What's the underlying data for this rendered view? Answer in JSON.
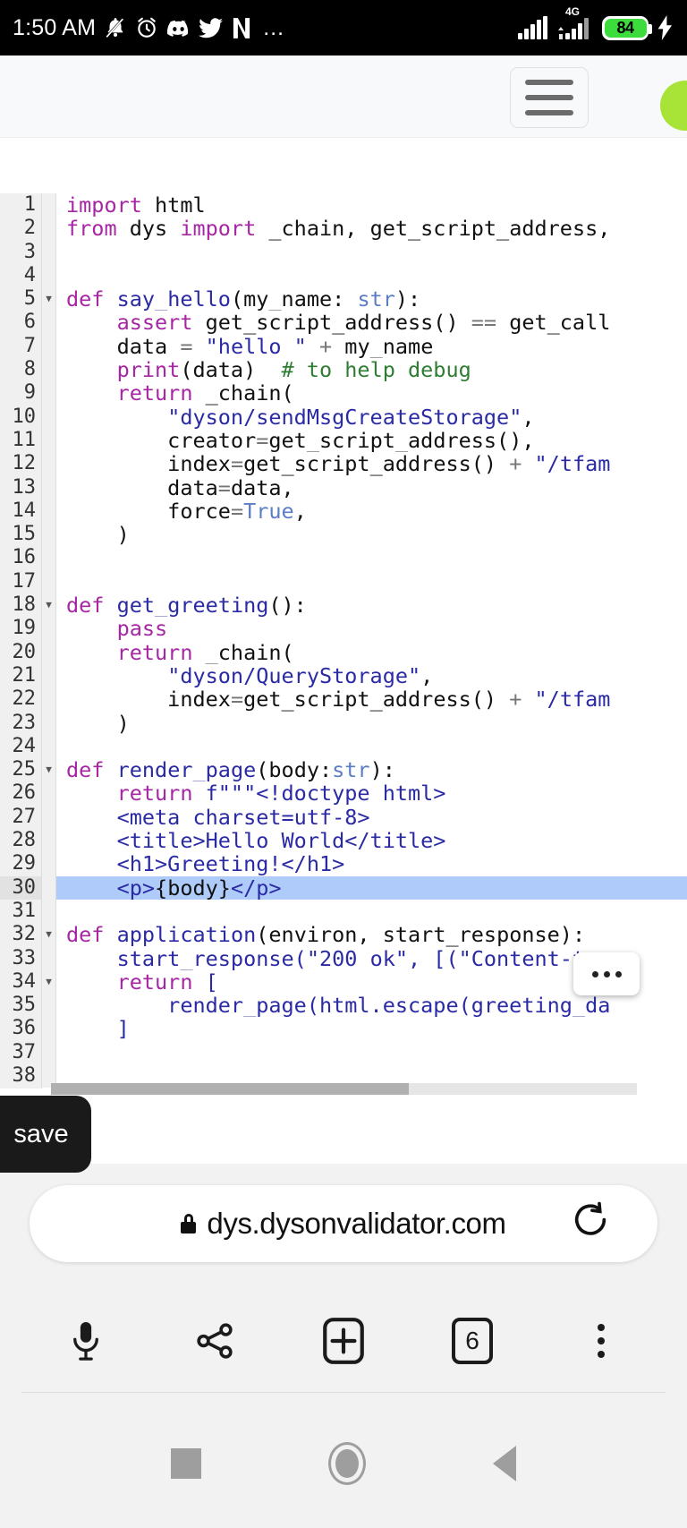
{
  "status_bar": {
    "time": "1:50 AM",
    "icons": [
      "bell-muted-icon",
      "alarm-clock-icon",
      "discord-icon",
      "twitter-icon",
      "netflix-icon"
    ],
    "overflow": "…",
    "network_label": "4G",
    "battery_percent": "84",
    "battery_color": "#3ddc3d",
    "charging": true
  },
  "page": {
    "menu_button": "hamburger-menu",
    "accent_color": "#a8e338"
  },
  "editor": {
    "selected_line": 30,
    "context_menu_label": "...",
    "save_tooltip": "save",
    "total_lines": 38,
    "lines": [
      {
        "n": 1,
        "fold": false,
        "tokens": [
          {
            "t": "import",
            "c": "kw"
          },
          {
            "t": " html",
            "c": "pl"
          }
        ]
      },
      {
        "n": 2,
        "fold": false,
        "tokens": [
          {
            "t": "from",
            "c": "kw"
          },
          {
            "t": " dys ",
            "c": "pl"
          },
          {
            "t": "import",
            "c": "kw"
          },
          {
            "t": " _chain, get_script_address,",
            "c": "pl"
          }
        ]
      },
      {
        "n": 3,
        "fold": false,
        "tokens": []
      },
      {
        "n": 4,
        "fold": false,
        "tokens": []
      },
      {
        "n": 5,
        "fold": true,
        "tokens": [
          {
            "t": "def",
            "c": "kw"
          },
          {
            "t": " ",
            "c": "pl"
          },
          {
            "t": "say_hello",
            "c": "fn"
          },
          {
            "t": "(my_name: ",
            "c": "pl"
          },
          {
            "t": "str",
            "c": "typ"
          },
          {
            "t": "):",
            "c": "pl"
          }
        ]
      },
      {
        "n": 6,
        "fold": false,
        "tokens": [
          {
            "t": "    ",
            "c": "pl"
          },
          {
            "t": "assert",
            "c": "kw"
          },
          {
            "t": " get_script_address() ",
            "c": "pl"
          },
          {
            "t": "==",
            "c": "op"
          },
          {
            "t": " get_call",
            "c": "pl"
          }
        ]
      },
      {
        "n": 7,
        "fold": false,
        "tokens": [
          {
            "t": "    data ",
            "c": "pl"
          },
          {
            "t": "=",
            "c": "op"
          },
          {
            "t": " \"hello \"",
            "c": "str"
          },
          {
            "t": " ",
            "c": "pl"
          },
          {
            "t": "+",
            "c": "op"
          },
          {
            "t": " my_name",
            "c": "pl"
          }
        ]
      },
      {
        "n": 8,
        "fold": false,
        "tokens": [
          {
            "t": "    ",
            "c": "pl"
          },
          {
            "t": "print",
            "c": "kw"
          },
          {
            "t": "(data)  ",
            "c": "pl"
          },
          {
            "t": "# to help debug",
            "c": "cmt"
          }
        ]
      },
      {
        "n": 9,
        "fold": false,
        "tokens": [
          {
            "t": "    ",
            "c": "pl"
          },
          {
            "t": "return",
            "c": "kw"
          },
          {
            "t": " _chain(",
            "c": "pl"
          }
        ]
      },
      {
        "n": 10,
        "fold": false,
        "tokens": [
          {
            "t": "        ",
            "c": "pl"
          },
          {
            "t": "\"dyson/sendMsgCreateStorage\"",
            "c": "str"
          },
          {
            "t": ",",
            "c": "pl"
          }
        ]
      },
      {
        "n": 11,
        "fold": false,
        "tokens": [
          {
            "t": "        creator",
            "c": "pl"
          },
          {
            "t": "=",
            "c": "op"
          },
          {
            "t": "get_script_address(),",
            "c": "pl"
          }
        ]
      },
      {
        "n": 12,
        "fold": false,
        "tokens": [
          {
            "t": "        index",
            "c": "pl"
          },
          {
            "t": "=",
            "c": "op"
          },
          {
            "t": "get_script_address() ",
            "c": "pl"
          },
          {
            "t": "+",
            "c": "op"
          },
          {
            "t": " ",
            "c": "pl"
          },
          {
            "t": "\"/tfam",
            "c": "str"
          }
        ]
      },
      {
        "n": 13,
        "fold": false,
        "tokens": [
          {
            "t": "        data",
            "c": "pl"
          },
          {
            "t": "=",
            "c": "op"
          },
          {
            "t": "data,",
            "c": "pl"
          }
        ]
      },
      {
        "n": 14,
        "fold": false,
        "tokens": [
          {
            "t": "        force",
            "c": "pl"
          },
          {
            "t": "=",
            "c": "op"
          },
          {
            "t": "True",
            "c": "typ"
          },
          {
            "t": ",",
            "c": "pl"
          }
        ]
      },
      {
        "n": 15,
        "fold": false,
        "tokens": [
          {
            "t": "    )",
            "c": "pl"
          }
        ]
      },
      {
        "n": 16,
        "fold": false,
        "tokens": []
      },
      {
        "n": 17,
        "fold": false,
        "tokens": []
      },
      {
        "n": 18,
        "fold": true,
        "tokens": [
          {
            "t": "def",
            "c": "kw"
          },
          {
            "t": " ",
            "c": "pl"
          },
          {
            "t": "get_greeting",
            "c": "fn"
          },
          {
            "t": "():",
            "c": "pl"
          }
        ]
      },
      {
        "n": 19,
        "fold": false,
        "tokens": [
          {
            "t": "    ",
            "c": "pl"
          },
          {
            "t": "pass",
            "c": "kw"
          }
        ]
      },
      {
        "n": 20,
        "fold": false,
        "tokens": [
          {
            "t": "    ",
            "c": "pl"
          },
          {
            "t": "return",
            "c": "kw"
          },
          {
            "t": " _chain(",
            "c": "pl"
          }
        ]
      },
      {
        "n": 21,
        "fold": false,
        "tokens": [
          {
            "t": "        ",
            "c": "pl"
          },
          {
            "t": "\"dyson/QueryStorage\"",
            "c": "str"
          },
          {
            "t": ",",
            "c": "pl"
          }
        ]
      },
      {
        "n": 22,
        "fold": false,
        "tokens": [
          {
            "t": "        index",
            "c": "pl"
          },
          {
            "t": "=",
            "c": "op"
          },
          {
            "t": "get_script_address() ",
            "c": "pl"
          },
          {
            "t": "+",
            "c": "op"
          },
          {
            "t": " ",
            "c": "pl"
          },
          {
            "t": "\"/tfam",
            "c": "str"
          }
        ]
      },
      {
        "n": 23,
        "fold": false,
        "tokens": [
          {
            "t": "    )",
            "c": "pl"
          }
        ]
      },
      {
        "n": 24,
        "fold": false,
        "tokens": []
      },
      {
        "n": 25,
        "fold": true,
        "tokens": [
          {
            "t": "def",
            "c": "kw"
          },
          {
            "t": " ",
            "c": "pl"
          },
          {
            "t": "render_page",
            "c": "fn"
          },
          {
            "t": "(body:",
            "c": "pl"
          },
          {
            "t": "str",
            "c": "typ"
          },
          {
            "t": "):",
            "c": "pl"
          }
        ]
      },
      {
        "n": 26,
        "fold": false,
        "tokens": [
          {
            "t": "    ",
            "c": "pl"
          },
          {
            "t": "return",
            "c": "kw"
          },
          {
            "t": " ",
            "c": "pl"
          },
          {
            "t": "f\"\"\"<!doctype html>",
            "c": "fn"
          }
        ]
      },
      {
        "n": 27,
        "fold": false,
        "tokens": [
          {
            "t": "    <meta charset=utf-8>",
            "c": "fn"
          }
        ]
      },
      {
        "n": 28,
        "fold": false,
        "tokens": [
          {
            "t": "    <title>Hello World</title>",
            "c": "fn"
          }
        ]
      },
      {
        "n": 29,
        "fold": false,
        "tokens": [
          {
            "t": "    <h1>Greeting!</h1>",
            "c": "fn"
          }
        ]
      },
      {
        "n": 30,
        "fold": false,
        "selected": true,
        "tokens": [
          {
            "t": "    <p>",
            "c": "fn"
          },
          {
            "t": "{body}",
            "c": "pl"
          },
          {
            "t": "</p>",
            "c": "fn"
          }
        ]
      },
      {
        "n": 31,
        "fold": false,
        "tokens": []
      },
      {
        "n": 32,
        "fold": true,
        "tokens": [
          {
            "t": "def",
            "c": "kw"
          },
          {
            "t": " ",
            "c": "pl"
          },
          {
            "t": "application",
            "c": "fn"
          },
          {
            "t": "(environ, start_response):",
            "c": "pl"
          }
        ]
      },
      {
        "n": 33,
        "fold": false,
        "tokens": [
          {
            "t": "    start_response(",
            "c": "fn"
          },
          {
            "t": "\"200 ok\"",
            "c": "fn"
          },
          {
            "t": ", [(",
            "c": "fn"
          },
          {
            "t": "\"Content-typ",
            "c": "fn"
          }
        ]
      },
      {
        "n": 34,
        "fold": true,
        "tokens": [
          {
            "t": "    ",
            "c": "pl"
          },
          {
            "t": "return",
            "c": "kw"
          },
          {
            "t": " [",
            "c": "fn"
          }
        ]
      },
      {
        "n": 35,
        "fold": false,
        "tokens": [
          {
            "t": "        render_page(html.escape(greeting_da",
            "c": "fn"
          }
        ]
      },
      {
        "n": 36,
        "fold": false,
        "tokens": [
          {
            "t": "    ]",
            "c": "fn"
          }
        ]
      },
      {
        "n": 37,
        "fold": false,
        "tokens": []
      },
      {
        "n": 38,
        "fold": false,
        "tokens": []
      }
    ]
  },
  "browser": {
    "url": "dys.dysonvalidator.com",
    "secure": true,
    "reload_label": "reload-icon",
    "toolbar": [
      {
        "name": "microphone-icon",
        "label": ""
      },
      {
        "name": "share-icon",
        "label": ""
      },
      {
        "name": "new-tab-icon",
        "label": "+"
      },
      {
        "name": "tab-switcher-icon",
        "label": "6"
      },
      {
        "name": "overflow-menu-icon",
        "label": ""
      }
    ],
    "tab_count": "6"
  },
  "navigation": {
    "recents": "recents-button",
    "home": "home-button",
    "back": "back-button"
  }
}
